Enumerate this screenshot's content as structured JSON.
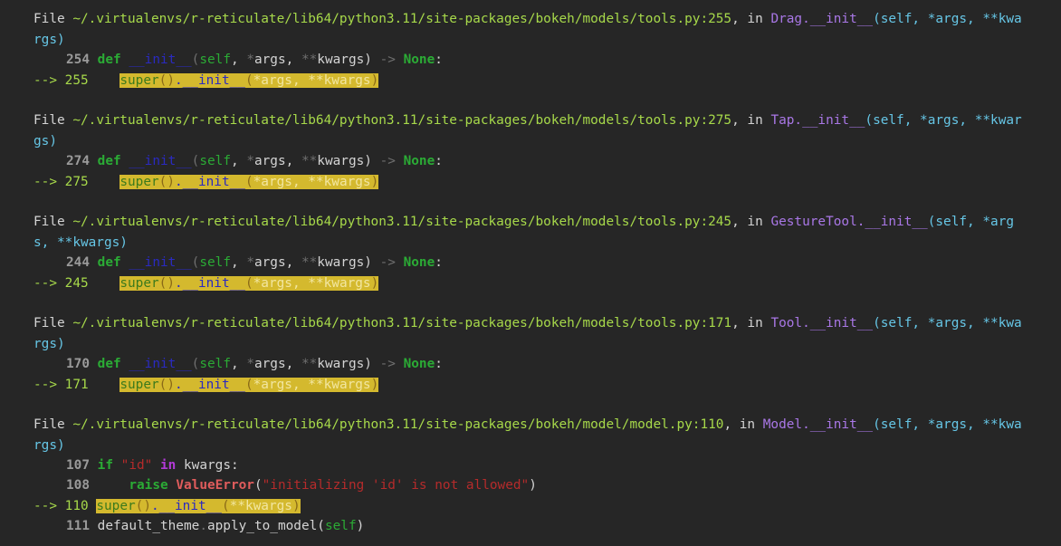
{
  "frames": [
    {
      "file_word": "File",
      "path": "~/.virtualenvs/r-reticulate/lib64/python3.11/site-packages/bokeh/models/tools.py:255",
      "in_word": ", in",
      "func": "Drag.__init__",
      "sig_line1": "(self, *args, **kwa",
      "sig_line2": "rgs)",
      "def_line_no": "254",
      "cur_arrow": "-->",
      "cur_line_no": "255",
      "call_a": "super",
      "call_b": "()",
      "call_c": ".__init__",
      "call_d": "(",
      "call_e": "*args, **kwargs",
      "call_f": ")"
    },
    {
      "file_word": "File",
      "path": "~/.virtualenvs/r-reticulate/lib64/python3.11/site-packages/bokeh/models/tools.py:275",
      "in_word": ", in",
      "func": "Tap.__init__",
      "sig_line1": "(self, *args, **kwar",
      "sig_line2": "gs)",
      "def_line_no": "274",
      "cur_arrow": "-->",
      "cur_line_no": "275",
      "call_a": "super",
      "call_b": "()",
      "call_c": ".__init__",
      "call_d": "(",
      "call_e": "*args, **kwargs",
      "call_f": ")"
    },
    {
      "file_word": "File",
      "path": "~/.virtualenvs/r-reticulate/lib64/python3.11/site-packages/bokeh/models/tools.py:245",
      "in_word": ", in",
      "func": "GestureTool.__init__",
      "sig_line1": "(self, *arg",
      "sig_line2": "s, **kwargs)",
      "def_line_no": "244",
      "cur_arrow": "-->",
      "cur_line_no": "245",
      "call_a": "super",
      "call_b": "()",
      "call_c": ".__init__",
      "call_d": "(",
      "call_e": "*args, **kwargs",
      "call_f": ")"
    },
    {
      "file_word": "File",
      "path": "~/.virtualenvs/r-reticulate/lib64/python3.11/site-packages/bokeh/models/tools.py:171",
      "in_word": ", in",
      "func": "Tool.__init__",
      "sig_line1": "(self, *args, **kwa",
      "sig_line2": "rgs)",
      "def_line_no": "170",
      "cur_arrow": "-->",
      "cur_line_no": "171",
      "call_a": "super",
      "call_b": "()",
      "call_c": ".__init__",
      "call_d": "(",
      "call_e": "*args, **kwargs",
      "call_f": ")"
    }
  ],
  "def_code": {
    "kw_def": "def",
    "fname": "__init__",
    "open": "(",
    "self": "self",
    "comma1": ", ",
    "star1": "*",
    "args": "args",
    "comma2": ", ",
    "star2": "**",
    "kwargs": "kwargs",
    "close": ") ",
    "arrow": "->",
    "none": "None",
    "colon": ":"
  },
  "last_frame": {
    "file_word": "File",
    "path": "~/.virtualenvs/r-reticulate/lib64/python3.11/site-packages/bokeh/model/model.py:110",
    "in_word": ", in",
    "func": "Model.__init__",
    "sig_line1": "(self, *args, **kwa",
    "sig_line2": "rgs)",
    "l107_no": "107",
    "l107_if": "if",
    "l107_str": "\"id\"",
    "l107_in": "in",
    "l107_rest": "kwargs:",
    "l108_no": "108",
    "l108_raise": "raise",
    "l108_exc": "ValueError",
    "l108_open": "(",
    "l108_msg": "\"initializing 'id' is not allowed\"",
    "l108_close": ")",
    "cur_arrow": "-->",
    "cur_line_no": "110",
    "l110_a": "super",
    "l110_b": "()",
    "l110_c": ".__init__",
    "l110_d": "(",
    "l110_e": "**kwargs",
    "l110_f": ")",
    "l111_no": "111",
    "l111_a": "default_theme",
    "l111_b": ".",
    "l111_c": "apply_to_model",
    "l111_d": "(",
    "l111_e": "self",
    "l111_f": ")"
  }
}
